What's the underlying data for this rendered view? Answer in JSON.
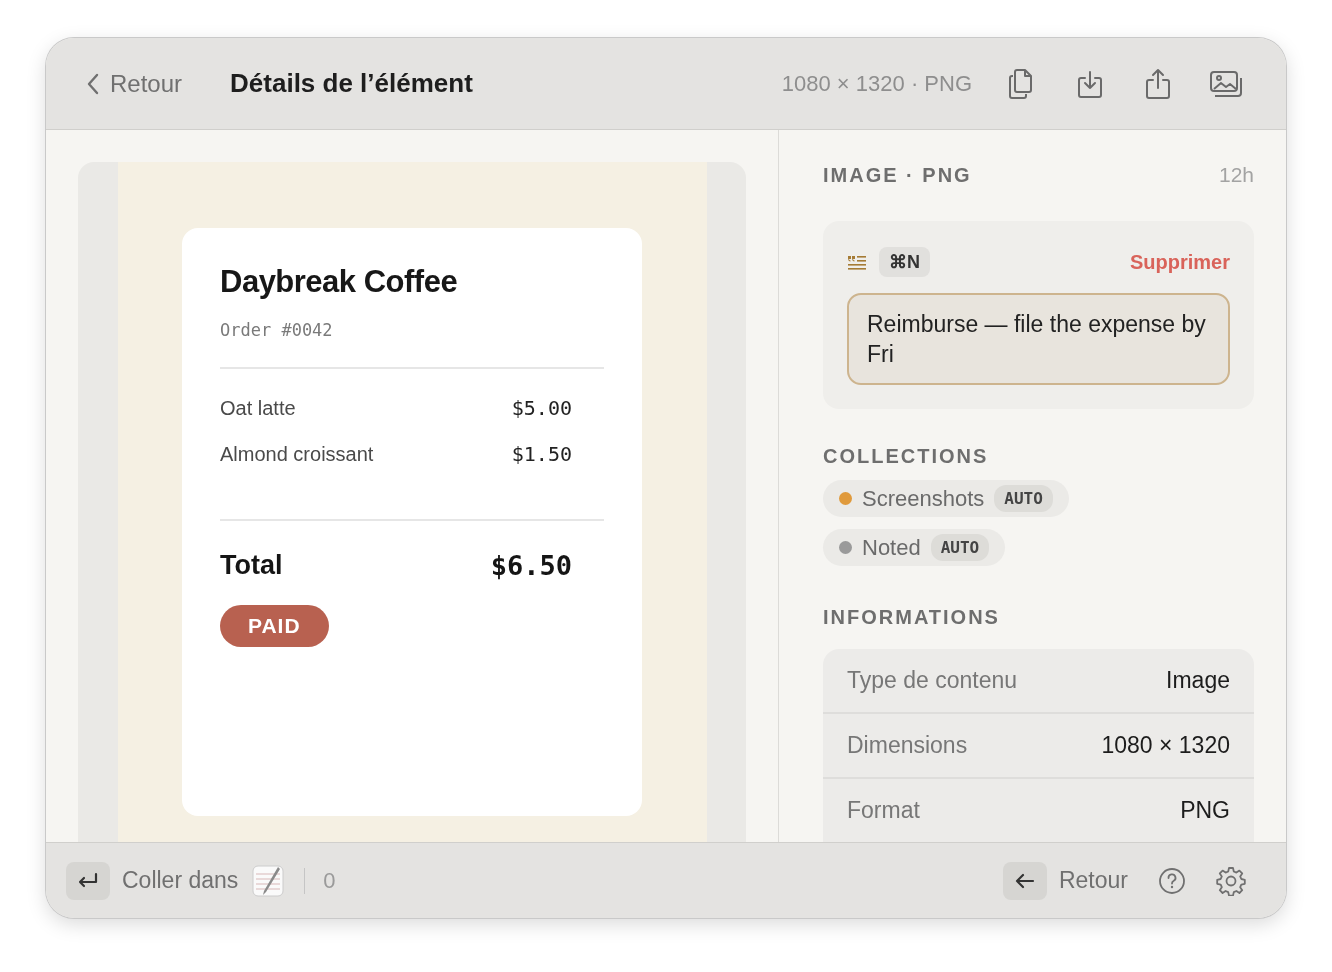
{
  "header": {
    "back": "Retour",
    "title": "Détails de l’élément",
    "meta": "1080 × 1320 · PNG"
  },
  "preview": {
    "kind": "screenshot",
    "receipt": {
      "shop": "Daybreak Coffee",
      "order": "Order #0042",
      "items": [
        {
          "name": "Oat latte",
          "price": "$5.00"
        },
        {
          "name": "Almond croissant",
          "price": "$1.50"
        }
      ],
      "total_label": "Total",
      "total": "$6.50",
      "status": "PAID"
    }
  },
  "details": {
    "type_label": "IMAGE · PNG",
    "age": "12h",
    "note": {
      "shortcut": "⌘N",
      "delete": "Supprimer",
      "text": "Reimburse — file the expense by Fri"
    },
    "collections_heading": "COLLECTIONS",
    "collections": [
      {
        "name": "Screenshots",
        "color": "#e09a3c",
        "badge": "AUTO"
      },
      {
        "name": "Noted",
        "color": "#9a9a9a",
        "badge": "AUTO"
      }
    ],
    "info_heading": "INFORMATIONS",
    "info": [
      {
        "label": "Type de contenu",
        "value": "Image"
      },
      {
        "label": "Dimensions",
        "value": "1080 × 1320"
      },
      {
        "label": "Format",
        "value": "PNG"
      }
    ]
  },
  "footer": {
    "paste": "Coller dans",
    "count": "0",
    "back": "Retour"
  }
}
